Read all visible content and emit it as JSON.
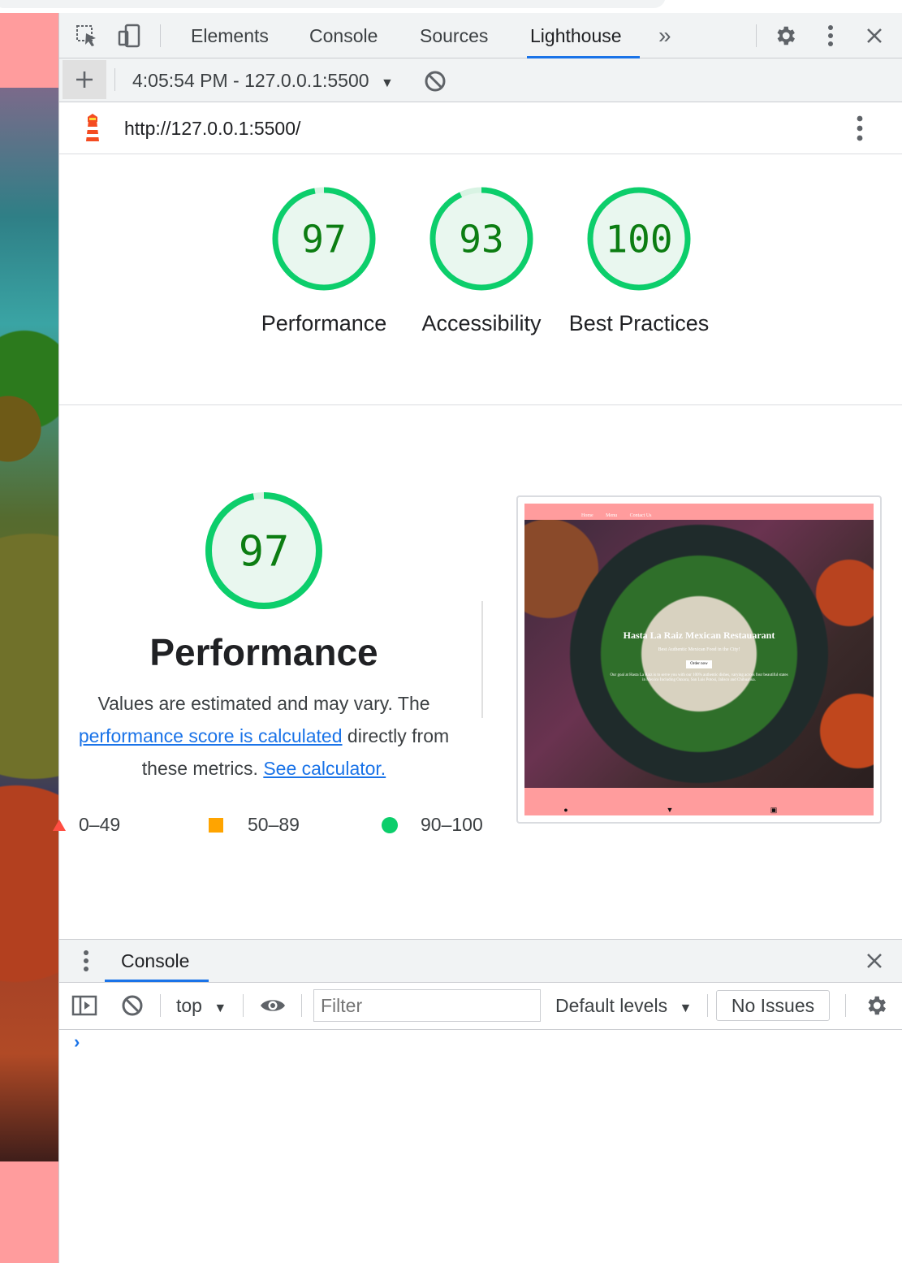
{
  "devtools": {
    "tabs": [
      "Elements",
      "Console",
      "Sources",
      "Lighthouse"
    ],
    "active_tab": "Lighthouse",
    "more_tabs_glyph": "»"
  },
  "report": {
    "selector": "4:05:54 PM - 127.0.0.1:5500",
    "url": "http://127.0.0.1:5500/"
  },
  "scores": [
    {
      "label": "Performance",
      "value": 97
    },
    {
      "label": "Accessibility",
      "value": 93
    },
    {
      "label": "Best Practices",
      "value": 100
    }
  ],
  "performance": {
    "score": 97,
    "title": "Performance",
    "desc_before": "Values are estimated and may vary. The",
    "desc_link": "performance score is calculated",
    "desc_middle": "directly from these metrics.",
    "desc_link2": "See calculator.",
    "legend": [
      {
        "range": "0–49",
        "color": "#ff4e42"
      },
      {
        "range": "50–89",
        "color": "#ffa400"
      },
      {
        "range": "90–100",
        "color": "#0cce6b"
      }
    ]
  },
  "thumbnail": {
    "nav": [
      "Home",
      "Menu",
      "Contact Us"
    ],
    "title": "Hasta La Raiz Mexican Restauarant",
    "subtitle": "Best Authentic Mexican Food in the City!",
    "button": "Order now",
    "copy": "Our goal at Hasta La Raiz is to serve you with our 100% authentic dishes, varying across four beautiful states in Mexico Including Oaxaca, San Luis Potosi, Jalisco and Chihuahua."
  },
  "drawer": {
    "tab": "Console",
    "context": "top",
    "filter_placeholder": "Filter",
    "levels": "Default levels",
    "issues": "No Issues",
    "prompt": "›"
  },
  "colors": {
    "pass": "#0cce6b",
    "pass_text": "#0c7d12",
    "accent": "#1a73e8",
    "page_bg": "#ff9c9d"
  }
}
